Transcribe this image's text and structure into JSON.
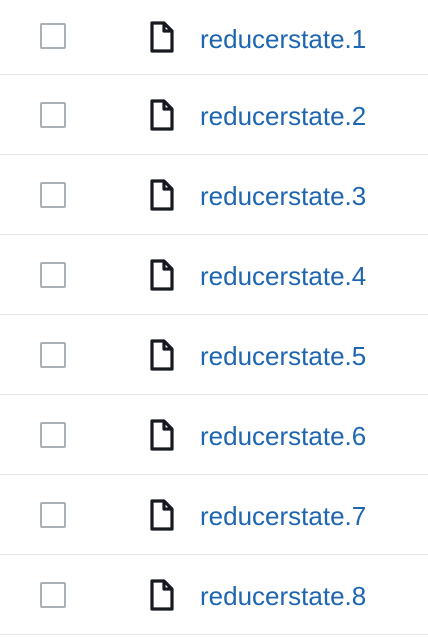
{
  "file_list": {
    "rows": [
      {
        "checkbox_checked": false,
        "icon": "file-icon",
        "name": "reducerstate.1"
      },
      {
        "checkbox_checked": false,
        "icon": "file-icon",
        "name": "reducerstate.2"
      },
      {
        "checkbox_checked": false,
        "icon": "file-icon",
        "name": "reducerstate.3"
      },
      {
        "checkbox_checked": false,
        "icon": "file-icon",
        "name": "reducerstate.4"
      },
      {
        "checkbox_checked": false,
        "icon": "file-icon",
        "name": "reducerstate.5"
      },
      {
        "checkbox_checked": false,
        "icon": "file-icon",
        "name": "reducerstate.6"
      },
      {
        "checkbox_checked": false,
        "icon": "file-icon",
        "name": "reducerstate.7"
      },
      {
        "checkbox_checked": false,
        "icon": "file-icon",
        "name": "reducerstate.8"
      }
    ]
  },
  "colors": {
    "link": "#1f66b0",
    "checkbox_border": "#a9b0b6",
    "row_divider": "#e5e7eb",
    "icon": "#16191f"
  }
}
